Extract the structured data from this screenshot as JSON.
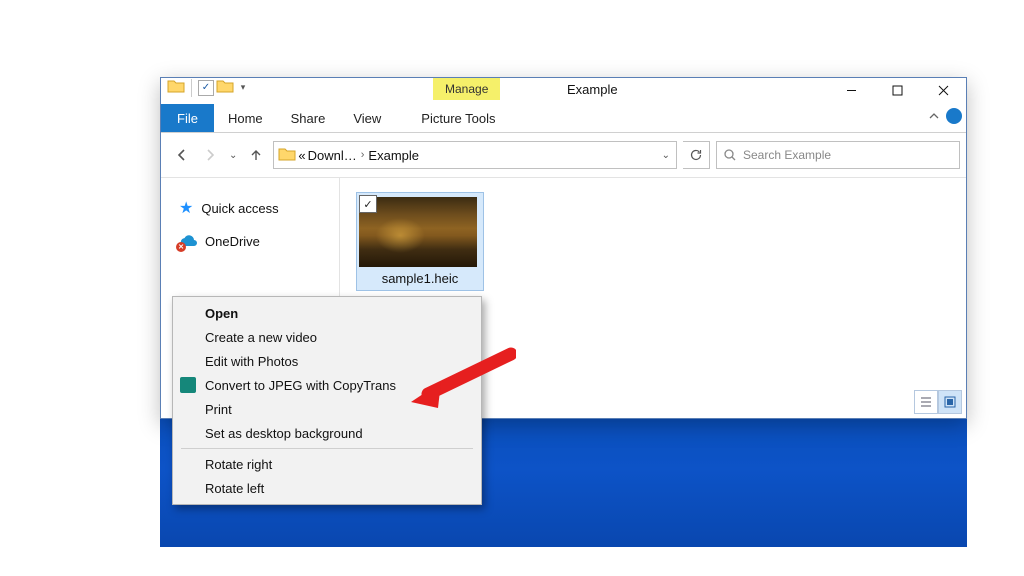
{
  "window": {
    "title": "Example",
    "manage_tab": "Manage",
    "ribbon": {
      "file": "File",
      "home": "Home",
      "share": "Share",
      "view": "View",
      "picture_tools": "Picture Tools"
    }
  },
  "address": {
    "seg1": "Downl…",
    "seg2": "Example"
  },
  "search": {
    "placeholder": "Search Example"
  },
  "sidebar": {
    "quick_access": "Quick access",
    "onedrive": "OneDrive"
  },
  "files": {
    "item1_label": "sample1.heic"
  },
  "context_menu": {
    "open": "Open",
    "create_video": "Create a new video",
    "edit_photos": "Edit with Photos",
    "convert_jpeg": "Convert to JPEG with CopyTrans",
    "print": "Print",
    "set_desktop_bg": "Set as desktop background",
    "rotate_right": "Rotate right",
    "rotate_left": "Rotate left"
  }
}
